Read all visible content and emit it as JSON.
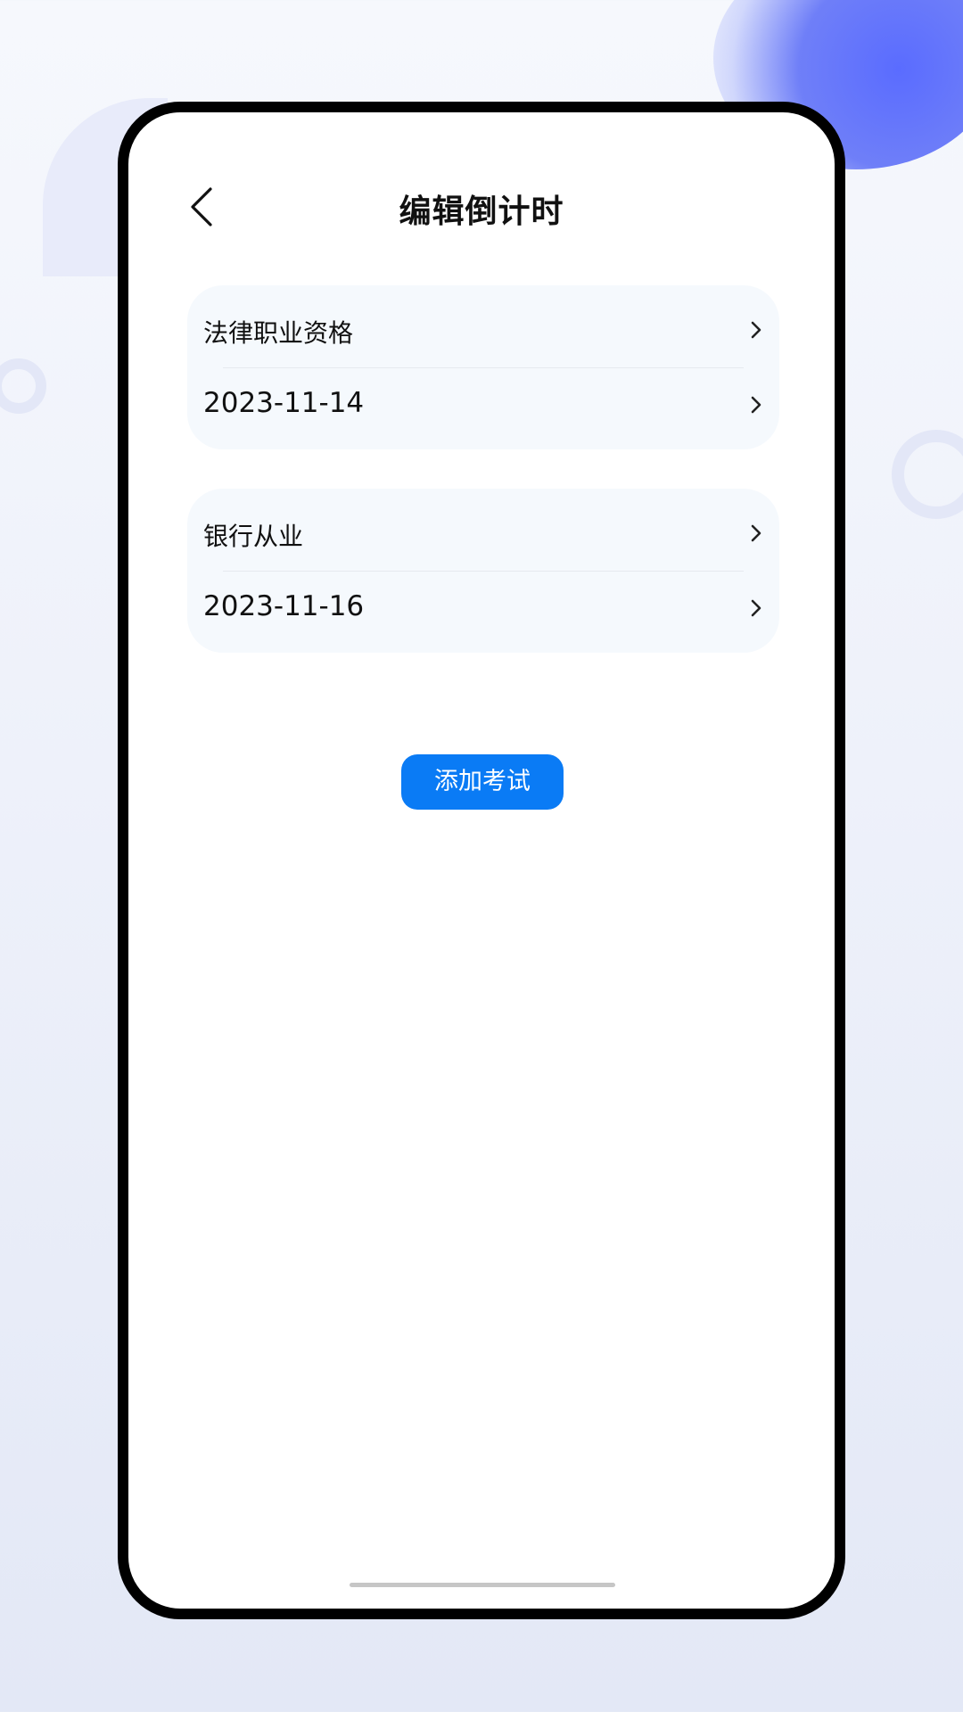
{
  "header": {
    "title": "编辑倒计时",
    "back_icon": "chevron-left-icon"
  },
  "exams": [
    {
      "name": "法律职业资格",
      "date": "2023-11-14"
    },
    {
      "name": "银行从业",
      "date": "2023-11-16"
    }
  ],
  "actions": {
    "add_label": "添加考试"
  },
  "colors": {
    "accent": "#0a7bf5",
    "card_background": "#f5f9fd",
    "frame": "#000000",
    "background_blob": "#5a6cff"
  }
}
